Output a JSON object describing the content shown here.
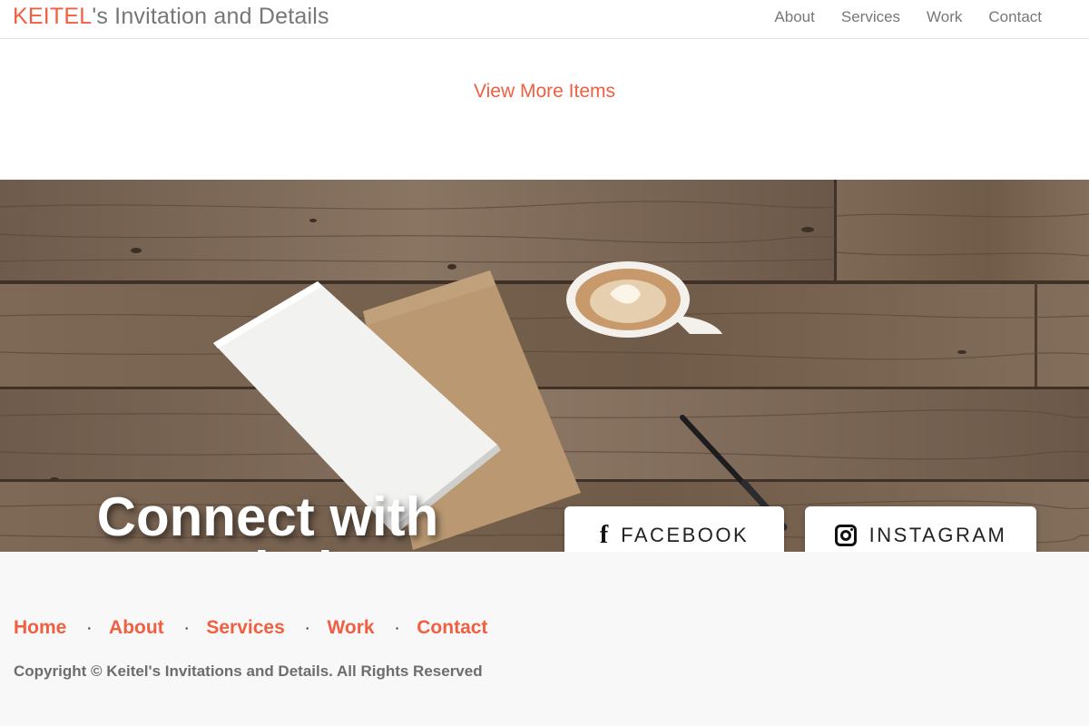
{
  "navbar": {
    "brand_accent": "KEITEL",
    "brand_rest": "'s Invitation and Details",
    "links": [
      "About",
      "Services",
      "Work",
      "Contact"
    ]
  },
  "view_more": {
    "label": "View More Items"
  },
  "hero": {
    "title": "Connect with Keitel:",
    "facebook_label": "FACEBOOK",
    "instagram_label": "INSTAGRAM",
    "facebook_icon": "f",
    "icons": {
      "facebook": "facebook-icon",
      "instagram": "instagram-icon"
    }
  },
  "footer": {
    "links": [
      "Home",
      "About",
      "Services",
      "Work",
      "Contact"
    ],
    "separator": "·",
    "copyright": "Copyright © Keitel's Invitations and Details. All Rights Reserved"
  },
  "colors": {
    "accent": "#f05f40",
    "muted_text": "#777777",
    "footer_bg": "#f8f8f8"
  }
}
